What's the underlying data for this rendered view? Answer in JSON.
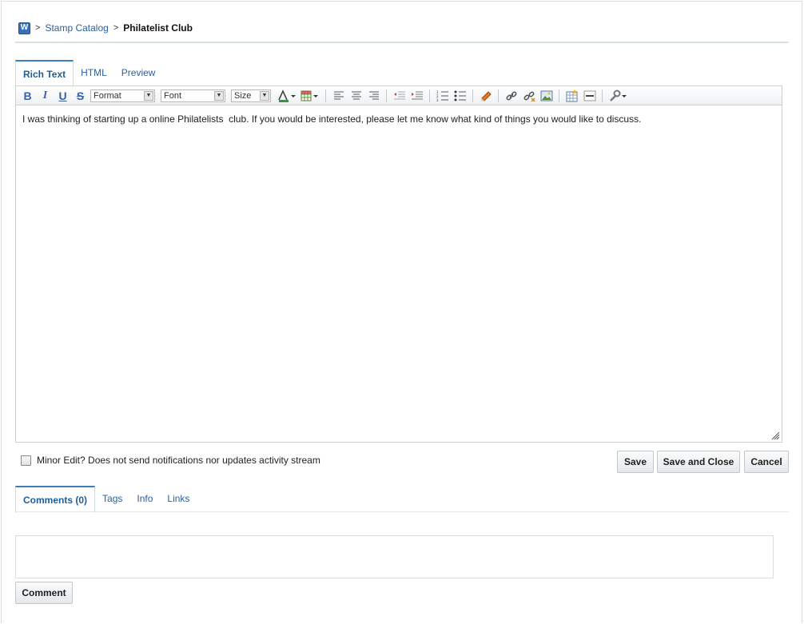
{
  "breadcrumb": {
    "icon_letter": "W",
    "sep": ">",
    "parent": "Stamp Catalog",
    "current": "Philatelist Club"
  },
  "editor_tabs": [
    {
      "label": "Rich Text",
      "active": true
    },
    {
      "label": "HTML",
      "active": false
    },
    {
      "label": "Preview",
      "active": false
    }
  ],
  "toolbar": {
    "bold": "B",
    "italic": "I",
    "underline": "U",
    "strike": "S",
    "format_select": "Format",
    "font_select": "Font",
    "size_select": "Size"
  },
  "editor": {
    "content": "I was thinking of starting up a online Philatelists  club. If you would be interested, please let me know what kind of things you would like to discuss."
  },
  "minor_edit": {
    "label": "Minor Edit? Does not send notifications nor updates activity stream",
    "checked": false
  },
  "actions": {
    "save": "Save",
    "save_close": "Save and Close",
    "cancel": "Cancel"
  },
  "bottom_tabs": [
    {
      "label": "Comments (0)",
      "active": true
    },
    {
      "label": "Tags",
      "active": false
    },
    {
      "label": "Info",
      "active": false
    },
    {
      "label": "Links",
      "active": false
    }
  ],
  "comment": {
    "button": "Comment",
    "value": ""
  },
  "colors": {
    "link": "#2b5f9e",
    "tab_active_border": "#3d7bbf",
    "rule": "#d6e4ea"
  }
}
